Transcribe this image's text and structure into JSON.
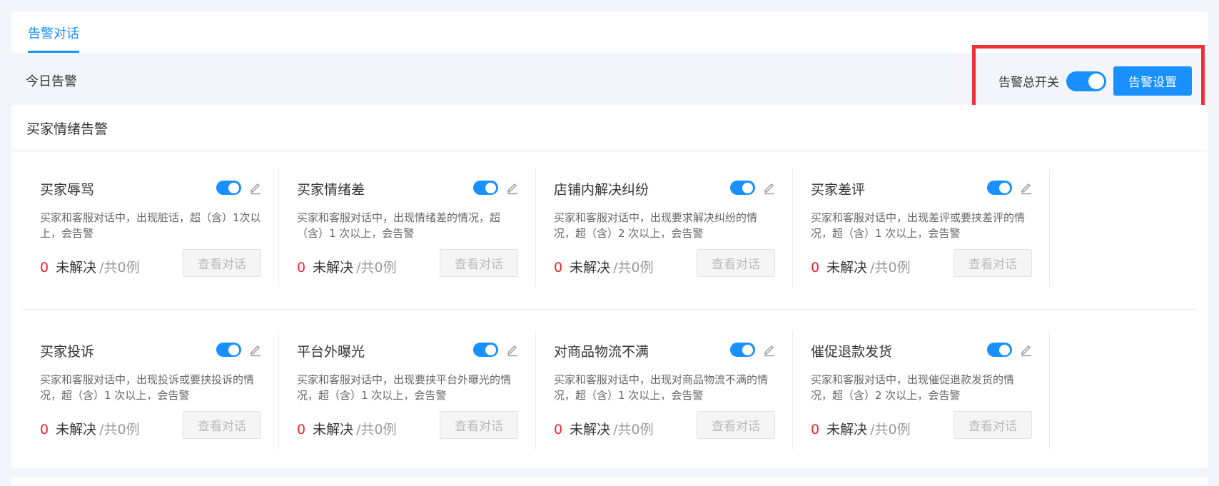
{
  "tabs": [
    {
      "label": "告警对话"
    }
  ],
  "header": {
    "today_label": "今日告警",
    "master_switch_label": "告警总开关",
    "master_switch_on": true,
    "settings_button": "告警设置"
  },
  "section": {
    "title": "买家情绪告警",
    "cards": [
      {
        "title": "买家辱骂",
        "enabled": true,
        "desc": "买家和客服对话中，出现脏话，超（含）1次以上，会告警",
        "count": "0",
        "unresolved_label": "未解决",
        "total": "/共0例",
        "view_button": "查看对话"
      },
      {
        "title": "买家情绪差",
        "enabled": true,
        "desc": "买家和客服对话中，出现情绪差的情况，超（含）1 次以上，会告警",
        "count": "0",
        "unresolved_label": "未解决",
        "total": "/共0例",
        "view_button": "查看对话"
      },
      {
        "title": "店铺内解决纠纷",
        "enabled": true,
        "desc": "买家和客服对话中，出现要求解决纠纷的情况，超（含）2 次以上，会告警",
        "count": "0",
        "unresolved_label": "未解决",
        "total": "/共0例",
        "view_button": "查看对话"
      },
      {
        "title": "买家差评",
        "enabled": true,
        "desc": "买家和客服对话中，出现差评或要挟差评的情况，超（含）1 次以上，会告警",
        "count": "0",
        "unresolved_label": "未解决",
        "total": "/共0例",
        "view_button": "查看对话"
      },
      {
        "title": "买家投诉",
        "enabled": true,
        "desc": "买家和客服对话中，出现投诉或要挟投诉的情况，超（含）1 次以上，会告警",
        "count": "0",
        "unresolved_label": "未解决",
        "total": "/共0例",
        "view_button": "查看对话"
      },
      {
        "title": "平台外曝光",
        "enabled": true,
        "desc": "买家和客服对话中，出现要挟平台外曝光的情况，超（含）1 次以上，会告警",
        "count": "0",
        "unresolved_label": "未解决",
        "total": "/共0例",
        "view_button": "查看对话"
      },
      {
        "title": "对商品物流不满",
        "enabled": true,
        "desc": "买家和客服对话中，出现对商品物流不满的情况，超（含）1 次以上，会告警",
        "count": "0",
        "unresolved_label": "未解决",
        "total": "/共0例",
        "view_button": "查看对话"
      },
      {
        "title": "催促退款发货",
        "enabled": true,
        "desc": "买家和客服对话中，出现催促退款发货的情况，超（含）2 次以上，会告警",
        "count": "0",
        "unresolved_label": "未解决",
        "total": "/共0例",
        "view_button": "查看对话"
      }
    ]
  },
  "colors": {
    "accent": "#1890ff",
    "danger": "#f5222d",
    "highlight": "#f0313a"
  }
}
